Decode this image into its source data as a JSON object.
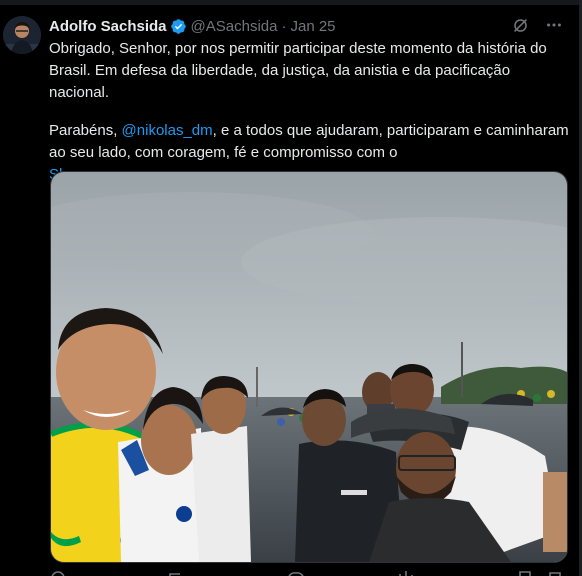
{
  "tweet": {
    "author_name": "Adolfo Sachsida",
    "author_handle": "@ASachsida",
    "separator": "·",
    "date": "Jan 25",
    "text_line1": "Obrigado, Senhor, por nos permitir participar deste momento da história do Brasil. Em defesa da liberdade, da justiça, da anistia e da pacificação nacional.",
    "text_p2_before": "Parabéns, ",
    "mention": "@nikolas_dm",
    "text_p2_after": ", e a todos que ajudaram, participaram e caminharam ao seu lado, com coragem, fé e compromisso com o",
    "show_more": "Show more"
  },
  "icons": {
    "verified": "verified-badge-icon",
    "grok": "grok-icon",
    "more": "more-options-icon"
  },
  "colors": {
    "background": "#000000",
    "text": "#e7e9ea",
    "secondary_text": "#71767b",
    "link": "#1d9bf0",
    "verified_badge": "#1d9bf0",
    "jersey_yellow": "#f2d21b",
    "jersey_green": "#00a04a"
  }
}
